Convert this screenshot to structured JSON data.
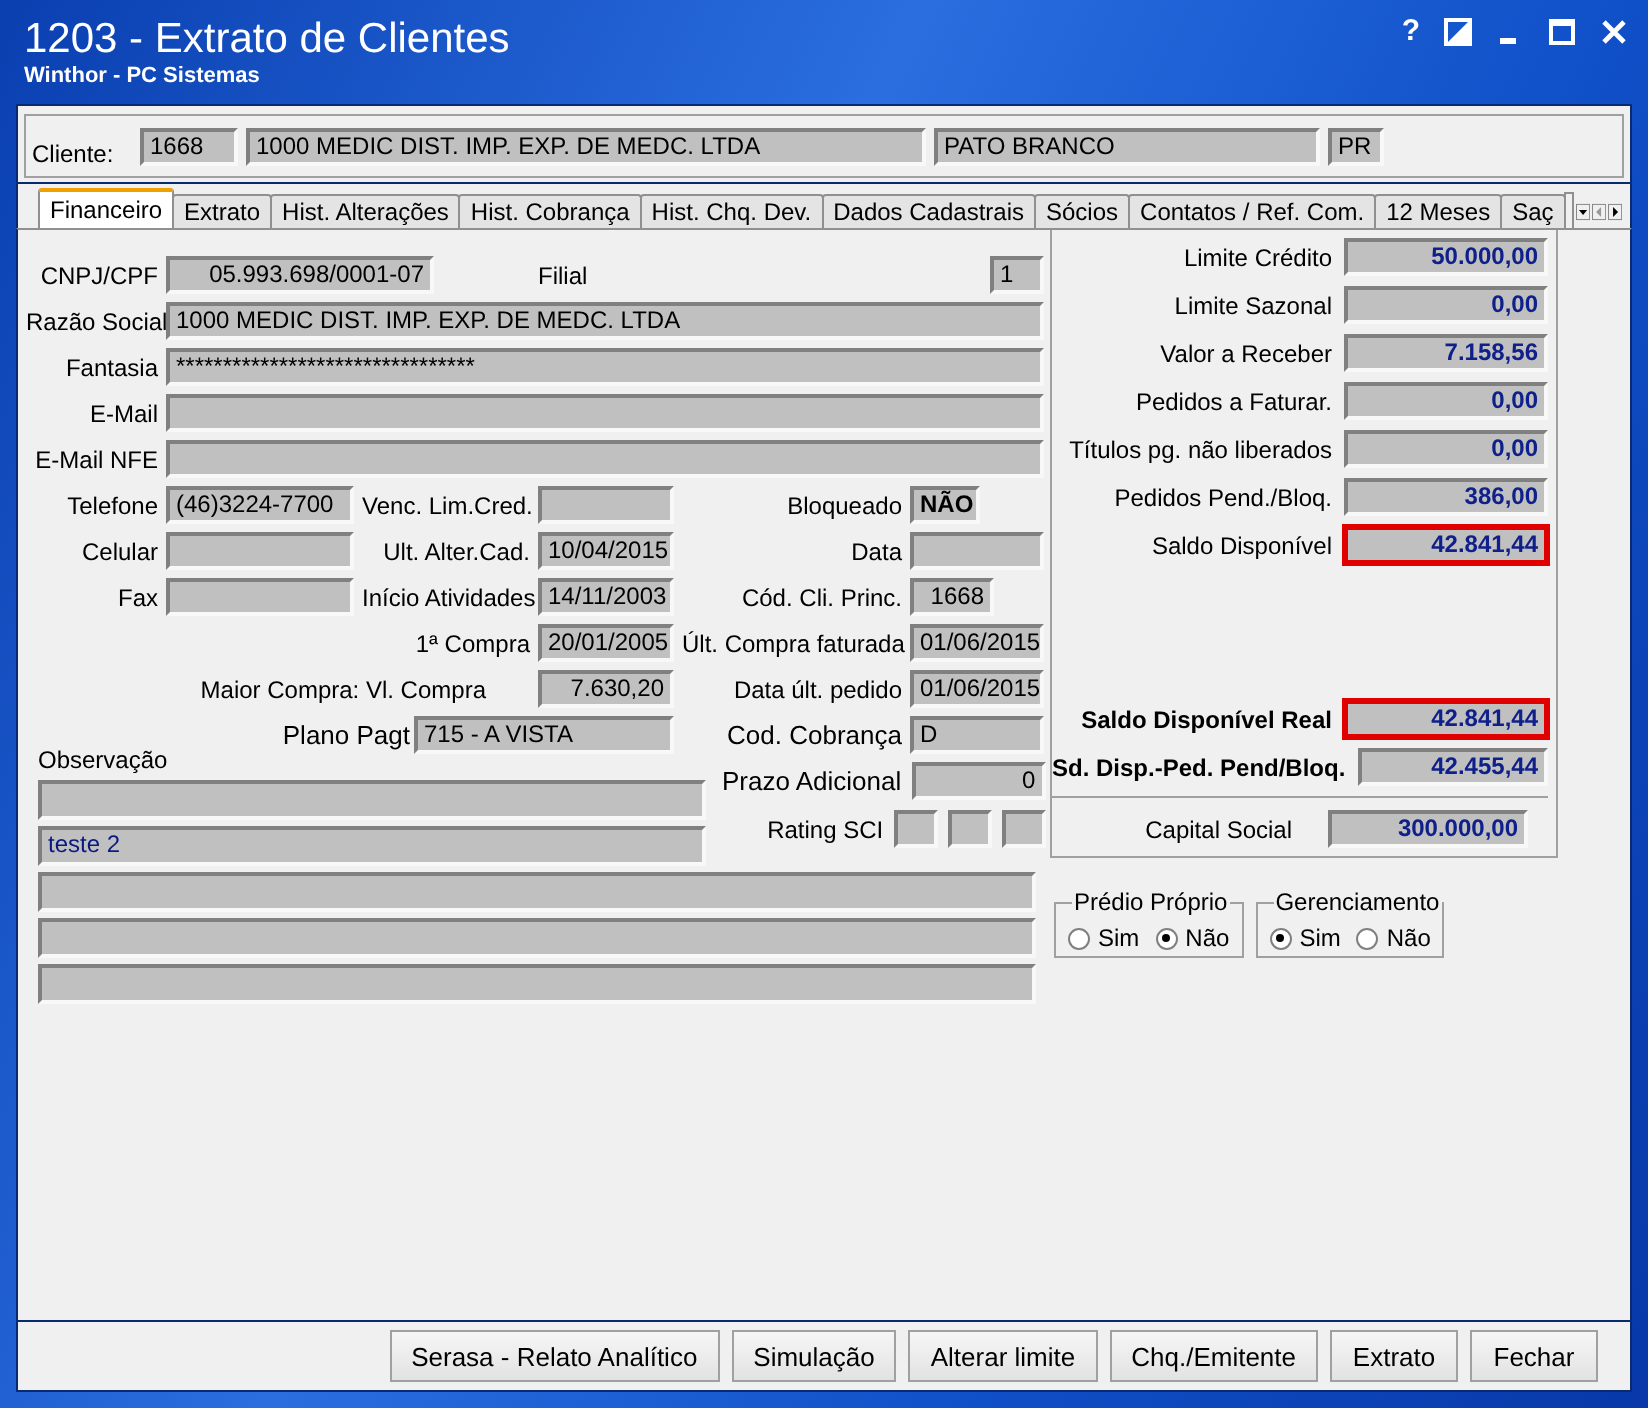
{
  "window": {
    "title": "1203 - Extrato de Clientes",
    "subtitle": "Winthor - PC Sistemas",
    "help": "?"
  },
  "client": {
    "label": "Cliente:",
    "code": "1668",
    "name": "1000 MEDIC DIST. IMP. EXP. DE MEDC. LTDA",
    "city": "PATO BRANCO",
    "state": "PR"
  },
  "tabs": [
    {
      "label": "Financeiro",
      "selected": true
    },
    {
      "label": "Extrato",
      "selected": false
    },
    {
      "label": "Hist. Alterações",
      "selected": false
    },
    {
      "label": "Hist. Cobrança",
      "selected": false
    },
    {
      "label": "Hist. Chq. Dev.",
      "selected": false
    },
    {
      "label": "Dados Cadastrais",
      "selected": false
    },
    {
      "label": "Sócios",
      "selected": false
    },
    {
      "label": "Contatos / Ref. Com.",
      "selected": false
    },
    {
      "label": "12 Meses",
      "selected": false
    },
    {
      "label": "Saç",
      "selected": false
    }
  ],
  "form": {
    "cnpj": {
      "label": "CNPJ/CPF",
      "value": "05.993.698/0001-07"
    },
    "filial": {
      "label": "Filial",
      "value": "1"
    },
    "razao": {
      "label": "Razão Social",
      "value": "1000 MEDIC DIST. IMP. EXP. DE MEDC. LTDA"
    },
    "fantasia": {
      "label": "Fantasia",
      "value": "********************************"
    },
    "email": {
      "label": "E-Mail"
    },
    "email_nfe": {
      "label": "E-Mail NFE"
    },
    "telefone": {
      "label": "Telefone",
      "value": "(46)3224-7700"
    },
    "venc_lim": {
      "label": "Venc. Lim.Cred."
    },
    "bloqueado": {
      "label": "Bloqueado",
      "value": "NÃO"
    },
    "celular": {
      "label": "Celular"
    },
    "ult_alter": {
      "label": "Ult. Alter.Cad.",
      "value": "10/04/2015"
    },
    "data": {
      "label": "Data"
    },
    "fax": {
      "label": "Fax"
    },
    "inicio": {
      "label": "Início Atividades",
      "value": "14/11/2003"
    },
    "cod_cli": {
      "label": "Cód. Cli. Princ.",
      "value": "1668"
    },
    "primeira_compra": {
      "label": "1ª Compra",
      "value": "20/01/2005"
    },
    "ult_compra": {
      "label": "Últ. Compra faturada",
      "value": "01/06/2015"
    },
    "maior_compra": {
      "label": "Maior Compra: Vl. Compra",
      "value": "7.630,20"
    },
    "data_ult_pedido": {
      "label": "Data últ. pedido",
      "value": "01/06/2015"
    },
    "plano": {
      "label": "Plano Pagt",
      "value": "715 - A VISTA"
    },
    "cod_cobranca": {
      "label": "Cod. Cobrança",
      "value": "D"
    },
    "observacao": {
      "label": "Observação",
      "value": "teste 2"
    },
    "prazo": {
      "label": "Prazo Adicional",
      "value": "0"
    },
    "rating": {
      "label": "Rating SCI"
    }
  },
  "summary": [
    {
      "label": "Limite Crédito",
      "value": "50.000,00",
      "highlighted": false,
      "emphasis": false
    },
    {
      "label": "Limite Sazonal",
      "value": "0,00",
      "highlighted": false,
      "emphasis": false
    },
    {
      "label": "Valor a Receber",
      "value": "7.158,56",
      "highlighted": false,
      "emphasis": false
    },
    {
      "label": "Pedidos a Faturar.",
      "value": "0,00",
      "highlighted": false,
      "emphasis": false
    },
    {
      "label": "Títulos pg. não liberados",
      "value": "0,00",
      "highlighted": false,
      "emphasis": false
    },
    {
      "label": "Pedidos Pend./Bloq.",
      "value": "386,00",
      "highlighted": false,
      "emphasis": false
    },
    {
      "label": "Saldo Disponível",
      "value": "42.841,44",
      "highlighted": true,
      "emphasis": false
    }
  ],
  "totals": [
    {
      "label": "Saldo Disponível Real",
      "value": "42.841,44",
      "highlighted": true,
      "emphasis": true
    },
    {
      "label": "Sd. Disp.-Ped. Pend/Bloq.",
      "value": "42.455,44",
      "highlighted": false,
      "emphasis": true
    }
  ],
  "capital": {
    "label": "Capital Social",
    "value": "300.000,00"
  },
  "radio_groups": [
    {
      "title": "Prédio Próprio",
      "options": [
        {
          "label": "Sim",
          "selected": false
        },
        {
          "label": "Não",
          "selected": true
        }
      ]
    },
    {
      "title": "Gerenciamento",
      "options": [
        {
          "label": "Sim",
          "selected": true
        },
        {
          "label": "Não",
          "selected": false
        }
      ]
    }
  ],
  "buttons": [
    "Serasa - Relato Analítico",
    "Simulação",
    "Alterar limite",
    "Chq./Emitente",
    "Extrato",
    "Fechar"
  ]
}
